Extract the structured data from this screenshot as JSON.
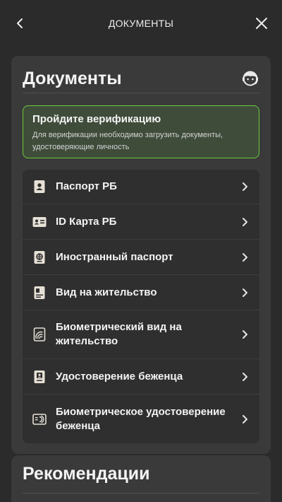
{
  "header": {
    "title": "ДОКУМЕНТЫ",
    "back_icon": "chevron-left-icon",
    "close_icon": "close-icon"
  },
  "documents_card": {
    "title": "Документы",
    "support_icon": "support-agent-icon"
  },
  "verification": {
    "title": "Пройдите верификацию",
    "text": "Для верификации необходимо загрузить документы, удостоверяющие личность",
    "accent": "#6ccb3b"
  },
  "documents": [
    {
      "label": "Паспорт РБ",
      "icon": "passport-icon"
    },
    {
      "label": "ID Карта РБ",
      "icon": "id-card-icon"
    },
    {
      "label": "Иностранный паспорт",
      "icon": "foreign-passport-icon"
    },
    {
      "label": "Вид на жительство",
      "icon": "residence-permit-icon"
    },
    {
      "label": "Биометрический вид на жительство",
      "icon": "biometric-residence-icon"
    },
    {
      "label": "Удостоверение беженца",
      "icon": "refugee-certificate-icon"
    },
    {
      "label": "Биометрическое удостоверение беженца",
      "icon": "biometric-refugee-icon"
    }
  ],
  "recommendations_card": {
    "title": "Рекомендации"
  }
}
